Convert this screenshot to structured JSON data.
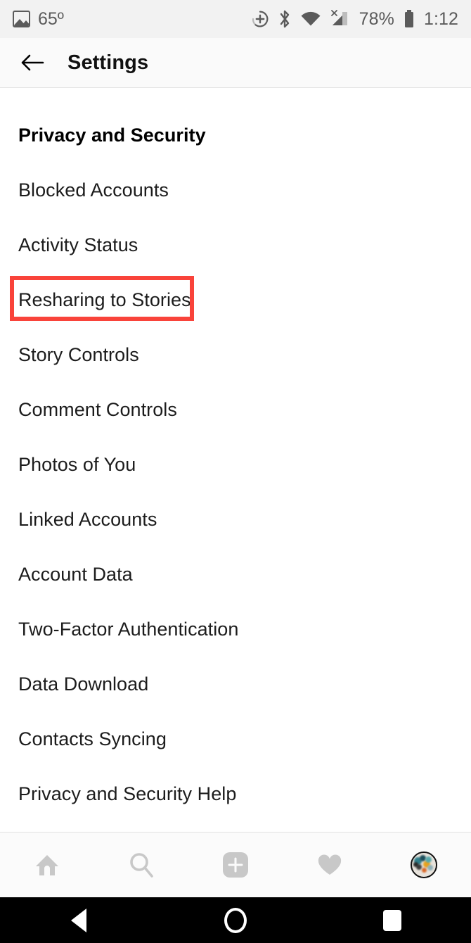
{
  "status_bar": {
    "photo_icon": "photo-icon",
    "temperature": "65º",
    "icons": [
      "dnd-plus-icon",
      "bluetooth-icon",
      "wifi-icon",
      "cellular-no-sim-icon"
    ],
    "battery_percent": "78%",
    "battery_icon": "battery-icon",
    "time": "1:12"
  },
  "header": {
    "back_icon": "back-arrow-icon",
    "title": "Settings"
  },
  "list": {
    "items": [
      {
        "label": "Privacy and Security",
        "type": "section",
        "highlighted": false
      },
      {
        "label": "Blocked Accounts",
        "type": "item",
        "highlighted": false
      },
      {
        "label": "Activity Status",
        "type": "item",
        "highlighted": false
      },
      {
        "label": "Resharing to Stories",
        "type": "item",
        "highlighted": true
      },
      {
        "label": "Story Controls",
        "type": "item",
        "highlighted": false
      },
      {
        "label": "Comment Controls",
        "type": "item",
        "highlighted": false
      },
      {
        "label": "Photos of You",
        "type": "item",
        "highlighted": false
      },
      {
        "label": "Linked Accounts",
        "type": "item",
        "highlighted": false
      },
      {
        "label": "Account Data",
        "type": "item",
        "highlighted": false
      },
      {
        "label": "Two-Factor Authentication",
        "type": "item",
        "highlighted": false
      },
      {
        "label": "Data Download",
        "type": "item",
        "highlighted": false
      },
      {
        "label": "Contacts Syncing",
        "type": "item",
        "highlighted": false
      },
      {
        "label": "Privacy and Security Help",
        "type": "item",
        "highlighted": false
      }
    ]
  },
  "tabbar": {
    "items": [
      {
        "name": "home-icon",
        "label": "Home"
      },
      {
        "name": "search-icon",
        "label": "Search"
      },
      {
        "name": "add-post-icon",
        "label": "Add"
      },
      {
        "name": "heart-activity-icon",
        "label": "Activity"
      },
      {
        "name": "profile-avatar",
        "label": "Profile"
      }
    ]
  },
  "navbar": {
    "items": [
      {
        "name": "android-back-button",
        "label": "Back"
      },
      {
        "name": "android-home-button",
        "label": "Home"
      },
      {
        "name": "android-recents-button",
        "label": "Recents"
      }
    ]
  },
  "colors": {
    "highlight": "#f9433a",
    "status_bar_bg": "#f2f2f2",
    "appbar_bg": "#fafafa",
    "tab_inactive": "#c8c8c8"
  }
}
